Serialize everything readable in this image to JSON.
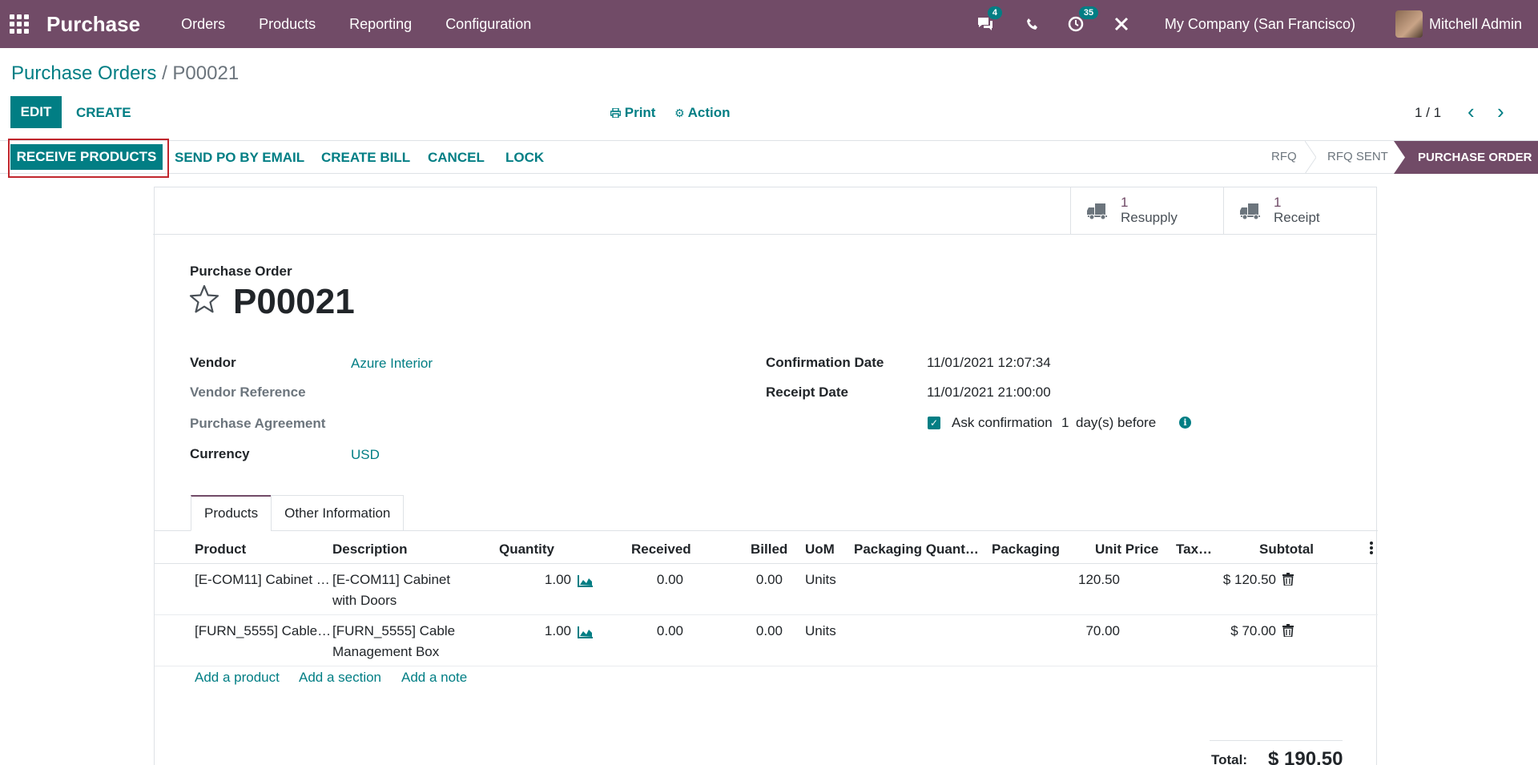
{
  "topbar": {
    "app_name": "Purchase",
    "menu": [
      "Orders",
      "Products",
      "Reporting",
      "Configuration"
    ],
    "messages_badge": "4",
    "activities_badge": "35",
    "company": "My Company (San Francisco)",
    "user": "Mitchell Admin"
  },
  "breadcrumb": {
    "parent": "Purchase Orders",
    "separator": "/",
    "current": "P00021"
  },
  "control": {
    "edit": "EDIT",
    "create": "CREATE",
    "print": "Print",
    "action": "Action",
    "pager": "1 / 1"
  },
  "statusbar": {
    "buttons": [
      "RECEIVE PRODUCTS",
      "SEND PO BY EMAIL",
      "CREATE BILL",
      "CANCEL",
      "LOCK"
    ],
    "stages": [
      "RFQ",
      "RFQ SENT",
      "PURCHASE ORDER"
    ],
    "active_stage": "PURCHASE ORDER"
  },
  "smart_buttons": [
    {
      "value": "1",
      "label": "Resupply"
    },
    {
      "value": "1",
      "label": "Receipt"
    }
  ],
  "form": {
    "title_label": "Purchase Order",
    "name": "P00021",
    "vendor_label": "Vendor",
    "vendor": "Azure Interior",
    "vendor_ref_label": "Vendor Reference",
    "agreement_label": "Purchase Agreement",
    "currency_label": "Currency",
    "currency": "USD",
    "confirmation_date_label": "Confirmation Date",
    "confirmation_date": "11/01/2021 12:07:34",
    "receipt_date_label": "Receipt Date",
    "receipt_date": "11/01/2021 21:00:00",
    "ask_confirmation_label": "Ask confirmation",
    "ask_confirmation_days": "1",
    "ask_confirmation_suffix": "day(s) before"
  },
  "tabs": [
    "Products",
    "Other Information"
  ],
  "table": {
    "headers": [
      "Product",
      "Description",
      "Quantity",
      "Received",
      "Billed",
      "UoM",
      "Packaging Quant…",
      "Packaging",
      "Unit Price",
      "Tax…",
      "Subtotal"
    ],
    "rows": [
      {
        "product": "[E-COM11] Cabinet …",
        "desc1": "[E-COM11] Cabinet",
        "desc2": "with Doors",
        "qty": "1.00",
        "received": "0.00",
        "billed": "0.00",
        "uom": "Units",
        "price": "120.50",
        "subtotal": "$ 120.50"
      },
      {
        "product": "[FURN_5555] Cable…",
        "desc1": "[FURN_5555] Cable",
        "desc2": "Management Box",
        "qty": "1.00",
        "received": "0.00",
        "billed": "0.00",
        "uom": "Units",
        "price": "70.00",
        "subtotal": "$ 70.00"
      }
    ],
    "add_links": [
      "Add a product",
      "Add a section",
      "Add a note"
    ],
    "total_label": "Total:",
    "total_value": "$ 190.50"
  },
  "colors": {
    "brand": "#714B67",
    "accent": "#017e84",
    "highlight": "#c0262d"
  }
}
